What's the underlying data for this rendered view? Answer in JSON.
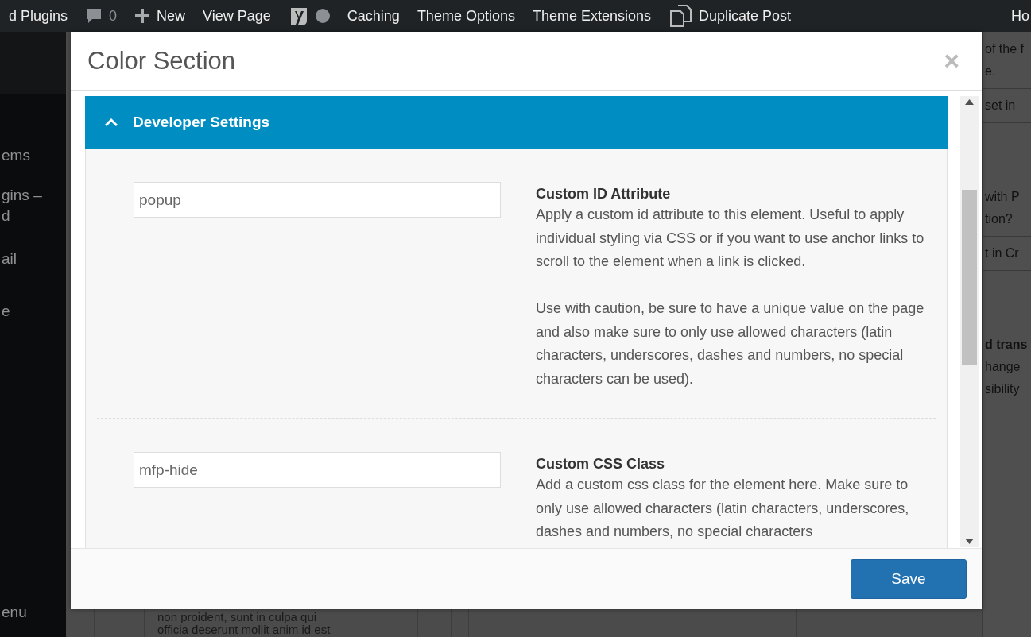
{
  "admin_bar": {
    "items": [
      {
        "kind": "text",
        "label": "d Plugins"
      },
      {
        "kind": "comments",
        "label": "0"
      },
      {
        "kind": "new",
        "label": "New"
      },
      {
        "kind": "text",
        "label": "View Page"
      },
      {
        "kind": "seo"
      },
      {
        "kind": "text",
        "label": "Caching"
      },
      {
        "kind": "text",
        "label": "Theme Options"
      },
      {
        "kind": "text",
        "label": "Theme Extensions"
      },
      {
        "kind": "duplicate",
        "label": "Duplicate Post"
      }
    ],
    "account": "Ho"
  },
  "sidebar": {
    "items": [
      {
        "label": "ems"
      },
      {
        "label": "gins –\nd"
      },
      {
        "label": "ail"
      },
      {
        "label": "e"
      }
    ],
    "collapse": "enu"
  },
  "background": {
    "right_lines": [
      {
        "kind": "plain",
        "label": "of the f"
      },
      {
        "kind": "plain",
        "label": "e."
      },
      {
        "kind": "rule"
      },
      {
        "kind": "plain",
        "label": "set in"
      },
      {
        "kind": "rule"
      },
      {
        "kind": "gap"
      },
      {
        "kind": "plain",
        "label": "with P"
      },
      {
        "kind": "plain",
        "label": "tion?"
      },
      {
        "kind": "rule"
      },
      {
        "kind": "plain",
        "label": "t in Cr"
      },
      {
        "kind": "rule"
      },
      {
        "kind": "gap"
      },
      {
        "kind": "bold",
        "label": "d trans"
      },
      {
        "kind": "plain",
        "label": "hange"
      },
      {
        "kind": "plain",
        "label": "sibility"
      }
    ],
    "bottom_text": [
      "non proident, sunt in culpa qui",
      "officia deserunt mollit anim id est"
    ]
  },
  "modal": {
    "title": "Color Section",
    "close": "×",
    "section": {
      "title": "Developer Settings",
      "expanded": true,
      "fields": [
        {
          "value": "popup",
          "label": "Custom ID Attribute",
          "description": [
            "Apply a custom id attribute to this element. Useful to apply individual styling via CSS or if you want to use anchor links to scroll to the element when a link is clicked.",
            "Use with caution, be sure to have a unique value on the page and also make sure to only use allowed characters (latin characters, underscores, dashes and numbers, no special characters can be used)."
          ]
        },
        {
          "value": "mfp-hide",
          "label": "Custom CSS Class",
          "description": [
            "Add a custom css class for the element here. Make sure to only use allowed characters (latin characters, underscores, dashes and numbers, no special characters"
          ]
        }
      ]
    },
    "save": "Save"
  }
}
